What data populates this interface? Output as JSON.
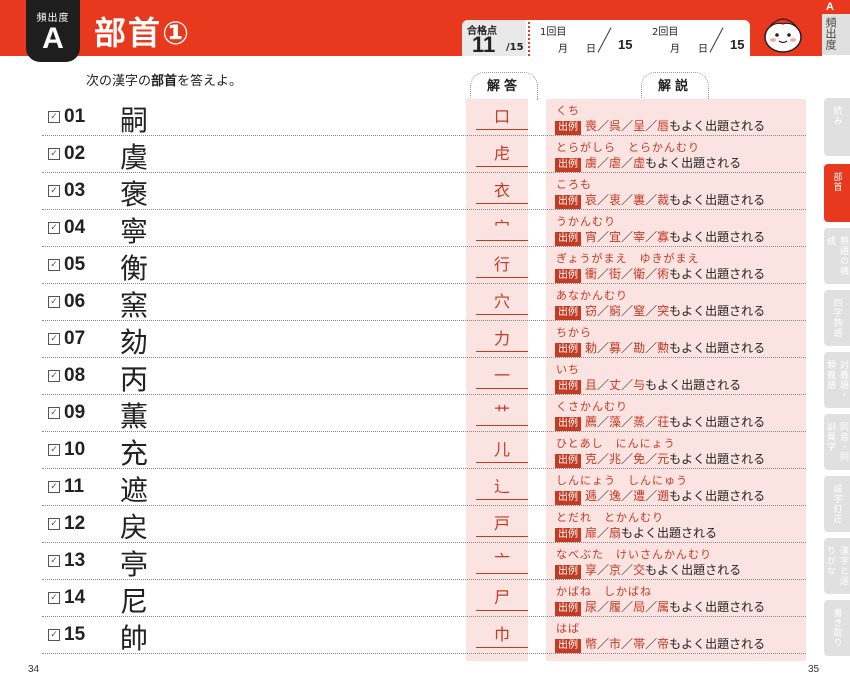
{
  "header": {
    "freq_label": "頻出度",
    "freq_rank": "A",
    "title": "部首①",
    "pass_label": "合格点",
    "pass_score": "11",
    "pass_total": "/15",
    "round1_label": "1回目",
    "round2_label": "2回目",
    "month_label": "月",
    "day_label": "日",
    "round_total": "15"
  },
  "side_tabs": {
    "rank": "A",
    "rank_label": "頻出度",
    "items": [
      {
        "label": "読み",
        "active": false
      },
      {
        "label": "部首",
        "active": true
      },
      {
        "label": "熟語の構成",
        "active": false
      },
      {
        "label": "四字熟語",
        "active": false
      },
      {
        "label": "対義語・類義語",
        "active": false
      },
      {
        "label": "同音・同訓異字",
        "active": false
      },
      {
        "label": "誤字訂正",
        "active": false
      },
      {
        "label": "漢字と送りがな",
        "active": false
      },
      {
        "label": "書き取り",
        "active": false
      }
    ]
  },
  "instruction": {
    "before": "次の漢字の",
    "bold": "部首",
    "after": "を答えよ。"
  },
  "columns": {
    "answer": "解答",
    "explanation": "解説"
  },
  "example_badge": "出例",
  "example_suffix": "もよく出題される",
  "slash": "／",
  "rows": [
    {
      "num": "01",
      "kanji": "嗣",
      "answer": "口",
      "reading": "くち",
      "examples": [
        "喪",
        "呉",
        "呈",
        "唇"
      ]
    },
    {
      "num": "02",
      "kanji": "虞",
      "answer": "虍",
      "reading": "とらがしら　とらかんむり",
      "examples": [
        "虜",
        "虐",
        "虚"
      ]
    },
    {
      "num": "03",
      "kanji": "褒",
      "answer": "衣",
      "reading": "ころも",
      "examples": [
        "哀",
        "衷",
        "裏",
        "裁"
      ]
    },
    {
      "num": "04",
      "kanji": "寧",
      "answer": "宀",
      "reading": "うかんむり",
      "examples": [
        "宵",
        "宜",
        "宰",
        "寡"
      ]
    },
    {
      "num": "05",
      "kanji": "衡",
      "answer": "行",
      "reading": "ぎょうがまえ　ゆきがまえ",
      "examples": [
        "衝",
        "街",
        "衛",
        "術"
      ]
    },
    {
      "num": "06",
      "kanji": "窯",
      "answer": "穴",
      "reading": "あなかんむり",
      "examples": [
        "窃",
        "窮",
        "窒",
        "突"
      ]
    },
    {
      "num": "07",
      "kanji": "劾",
      "answer": "力",
      "reading": "ちから",
      "examples": [
        "勅",
        "募",
        "勘",
        "勲"
      ]
    },
    {
      "num": "08",
      "kanji": "丙",
      "answer": "一",
      "reading": "いち",
      "examples": [
        "且",
        "丈",
        "与"
      ]
    },
    {
      "num": "09",
      "kanji": "薫",
      "answer": "艹",
      "reading": "くさかんむり",
      "examples": [
        "薦",
        "藻",
        "蒸",
        "荘"
      ]
    },
    {
      "num": "10",
      "kanji": "充",
      "answer": "儿",
      "reading": "ひとあし　にんにょう",
      "examples": [
        "克",
        "兆",
        "免",
        "元"
      ]
    },
    {
      "num": "11",
      "kanji": "遮",
      "answer": "辶",
      "reading": "しんにょう　しんにゅう",
      "examples": [
        "逓",
        "逸",
        "遭",
        "遡"
      ]
    },
    {
      "num": "12",
      "kanji": "戻",
      "answer": "戸",
      "reading": "とだれ　とかんむり",
      "examples": [
        "扉",
        "扇"
      ]
    },
    {
      "num": "13",
      "kanji": "亭",
      "answer": "亠",
      "reading": "なべぶた　けいさんかんむり",
      "examples": [
        "享",
        "京",
        "交"
      ]
    },
    {
      "num": "14",
      "kanji": "尼",
      "answer": "尸",
      "reading": "かばね　しかばね",
      "examples": [
        "尿",
        "履",
        "局",
        "属"
      ]
    },
    {
      "num": "15",
      "kanji": "帥",
      "answer": "巾",
      "reading": "はば",
      "examples": [
        "幣",
        "市",
        "帯",
        "帝"
      ]
    }
  ],
  "page_numbers": {
    "left": "34",
    "right": "35"
  },
  "colors": {
    "accent": "#e8391e",
    "answer_bg": "#fbe3e1",
    "answer_text": "#c53a22"
  }
}
